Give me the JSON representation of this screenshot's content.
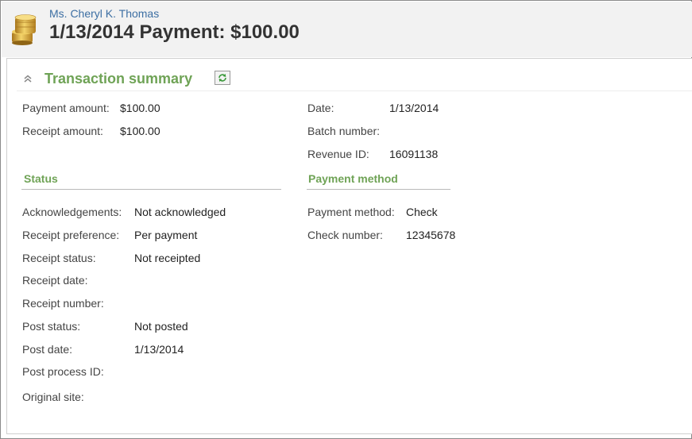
{
  "header": {
    "constituent_name": "Ms. Cheryl K. Thomas",
    "title": "1/13/2014 Payment: $100.00",
    "icon": "coins-icon"
  },
  "transaction_summary": {
    "title": "Transaction summary",
    "collapse_icon": "chevron-double-up-icon",
    "refresh_icon": "refresh-icon",
    "left_fields": [
      {
        "label": "Payment amount:",
        "value": "$100.00"
      },
      {
        "label": "Receipt amount:",
        "value": "$100.00"
      }
    ],
    "right_fields": [
      {
        "label": "Date:",
        "value": "1/13/2014"
      },
      {
        "label": "Batch number:",
        "value": ""
      },
      {
        "label": "Revenue ID:",
        "value": "16091138"
      }
    ]
  },
  "status": {
    "title": "Status",
    "fields": [
      {
        "label": "Acknowledgements:",
        "value": "Not acknowledged"
      },
      {
        "label": "Receipt preference:",
        "value": "Per payment"
      },
      {
        "label": "Receipt status:",
        "value": "Not receipted"
      },
      {
        "label": "Receipt date:",
        "value": ""
      },
      {
        "label": "Receipt number:",
        "value": ""
      },
      {
        "label": "Post status:",
        "value": "Not posted"
      },
      {
        "label": "Post date:",
        "value": "1/13/2014"
      },
      {
        "label": "Post process ID:",
        "value": ""
      },
      {
        "label": "Original site:",
        "value": ""
      }
    ]
  },
  "payment_method": {
    "title": "Payment method",
    "fields": [
      {
        "label": "Payment method:",
        "value": "Check"
      },
      {
        "label": "Check number:",
        "value": "12345678"
      }
    ]
  },
  "colors": {
    "accent_green": "#6fa356",
    "link_blue": "#3d6fa3",
    "header_bg": "#f2f2f2"
  }
}
